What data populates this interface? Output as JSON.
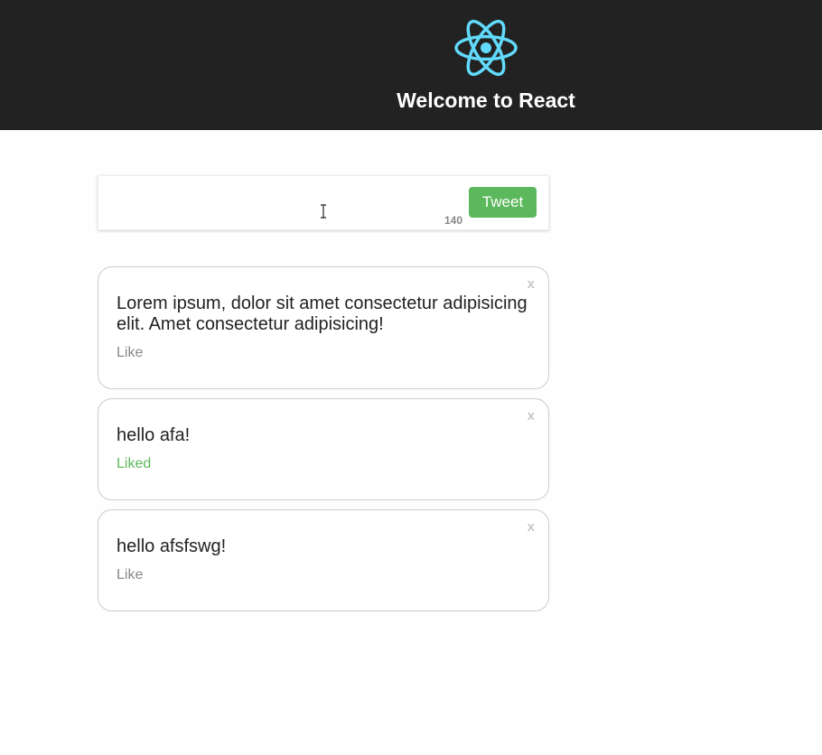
{
  "header": {
    "title": "Welcome to React",
    "logo_icon": "react-atom-icon",
    "logo_color": "#61dafb",
    "background": "#222222"
  },
  "composer": {
    "input_value": "",
    "char_count": "140",
    "tweet_label": "Tweet",
    "tweet_color": "#5cb85c"
  },
  "tweets": [
    {
      "text": "Lorem ipsum, dolor sit amet consectetur adipisicing elit. Amet consectetur adipisicing!",
      "like_label": "Like",
      "liked": false,
      "close_label": "x"
    },
    {
      "text": "hello afa!",
      "like_label": "Liked",
      "liked": true,
      "close_label": "x"
    },
    {
      "text": "hello afsfswg!",
      "like_label": "Like",
      "liked": false,
      "close_label": "x"
    }
  ]
}
